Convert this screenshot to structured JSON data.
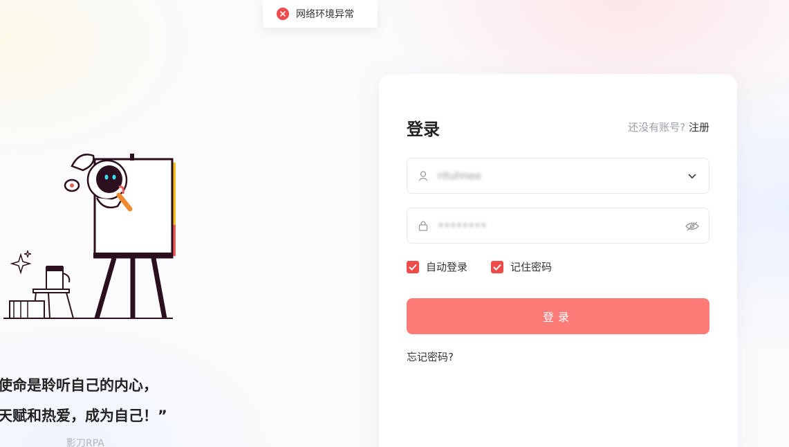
{
  "toast": {
    "message": "网络环境异常",
    "icon": "close-circle-icon",
    "color": "#f04b4b"
  },
  "quote": {
    "line1": "的使命是聆听自己的内心，",
    "line2": "到天赋和热爱，成为自己！”",
    "author": "影刀RPA"
  },
  "login": {
    "title": "登录",
    "register_prompt": "还没有账号?",
    "register_link": "注册",
    "username_value": "rituhnee",
    "password_value": "••••••••",
    "auto_login_label": "自动登录",
    "auto_login_checked": true,
    "remember_label": "记住密码",
    "remember_checked": true,
    "submit_label": "登录",
    "forgot_label": "忘记密码?"
  },
  "colors": {
    "accent": "#f04b4b",
    "button": "#ff7b78"
  }
}
